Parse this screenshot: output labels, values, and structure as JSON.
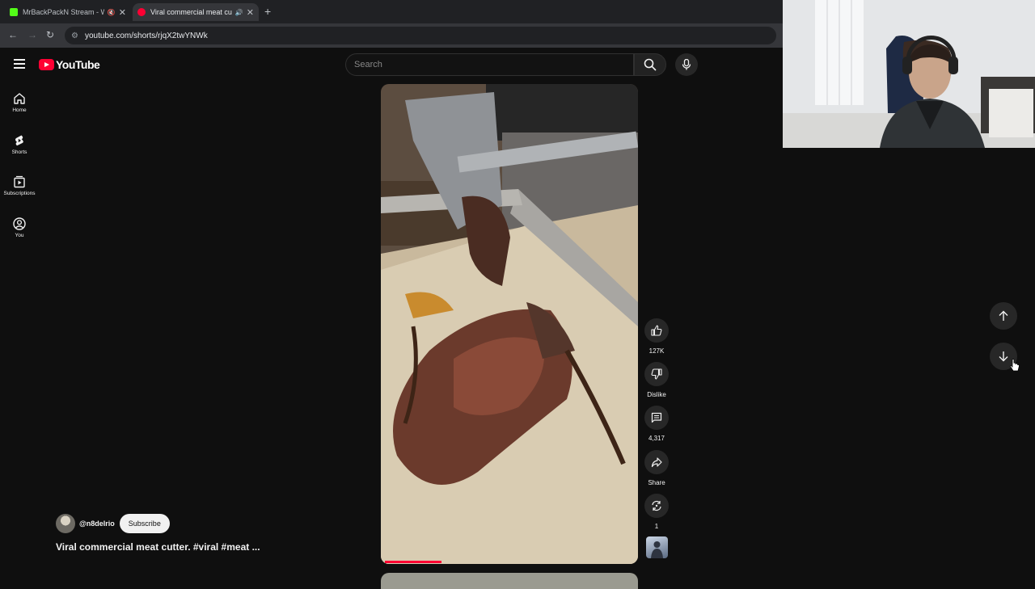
{
  "browser": {
    "tabs": [
      {
        "title": "MrBackPackN Stream - Wa",
        "favicon_color": "#53fc18"
      },
      {
        "title": "Viral commercial meat cutt",
        "favicon_color": "#ff0033"
      }
    ],
    "url": "youtube.com/shorts/rjqX2twYNWk"
  },
  "header": {
    "logo_text": "YouTube",
    "search_placeholder": "Search"
  },
  "sidebar": {
    "items": [
      {
        "label": "Home",
        "icon": "home-icon"
      },
      {
        "label": "Shorts",
        "icon": "shorts-icon"
      },
      {
        "label": "Subscriptions",
        "icon": "subscriptions-icon"
      },
      {
        "label": "You",
        "icon": "account-icon"
      }
    ]
  },
  "actions": {
    "like_count": "127K",
    "dislike_label": "Dislike",
    "comment_count": "4,317",
    "share_label": "Share",
    "remix_count": "1"
  },
  "video": {
    "channel_handle": "@n8delrio",
    "subscribe_label": "Subscribe",
    "title": "Viral commercial meat cutter. #viral #meat ...",
    "progress": 0.22
  },
  "colors": {
    "accent": "#ff0033",
    "background": "#0f0f0f"
  }
}
